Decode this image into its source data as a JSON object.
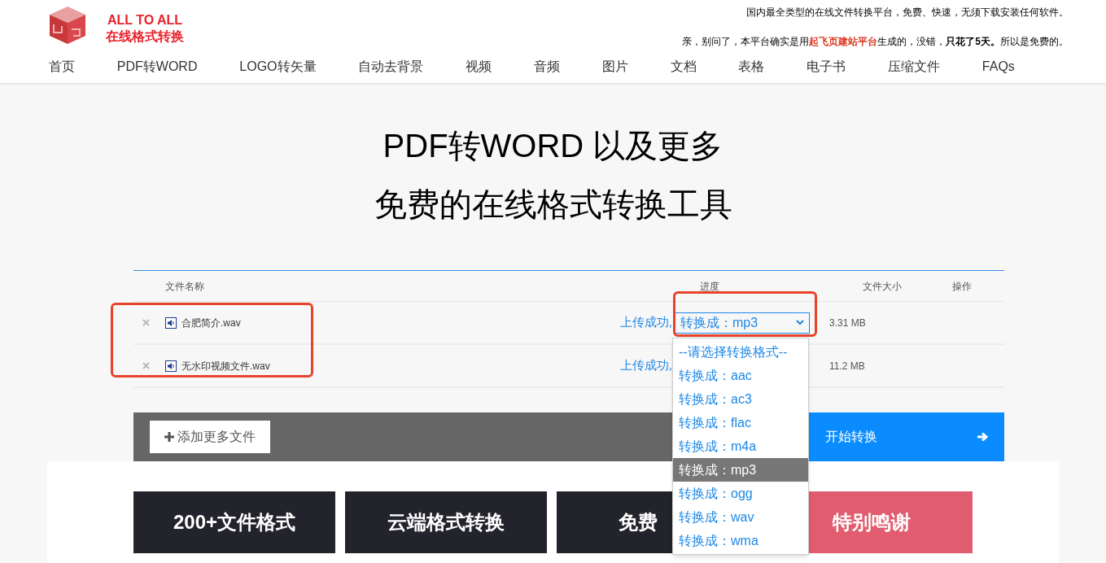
{
  "header": {
    "logo_title": "ALL TO ALL",
    "logo_subtitle": "在线格式转换",
    "tagline": "国内最全类型的在线文件转换平台，免费、快速，无须下载安装任何软件。",
    "notice": [
      {
        "kind": "plain",
        "text": "亲，别问了，本平台确实是用"
      },
      {
        "kind": "link",
        "text": "起飞页建站平台"
      },
      {
        "kind": "plain",
        "text": "生成的，没错，"
      },
      {
        "kind": "bold",
        "text": "只花了5天。"
      },
      {
        "kind": "plain",
        "text": "所以是免费的。"
      }
    ]
  },
  "nav": [
    "首页",
    "PDF转WORD",
    "LOGO转矢量",
    "自动去背景",
    "视频",
    "音频",
    "图片",
    "文档",
    "表格",
    "电子书",
    "压缩文件",
    "FAQs"
  ],
  "hero": [
    "PDF转WORD 以及更多",
    "免费的在线格式转换工具"
  ],
  "table": {
    "columns": [
      "文件名称",
      "进度",
      "文件大小",
      "操作"
    ],
    "rows": [
      {
        "name": "合肥简介.wav",
        "status": "上传成功,",
        "format": "转换成：mp3",
        "size": "3.31 MB"
      },
      {
        "name": "无水印视频文件.wav",
        "status": "上传成功,",
        "format": "",
        "size": "11.2 MB"
      }
    ]
  },
  "dropdown": [
    {
      "label": "--请选择转换格式--",
      "selected": false
    },
    {
      "label": "转换成：aac",
      "selected": false
    },
    {
      "label": "转换成：ac3",
      "selected": false
    },
    {
      "label": "转换成：flac",
      "selected": false
    },
    {
      "label": "转换成：m4a",
      "selected": false
    },
    {
      "label": "转换成：mp3",
      "selected": true
    },
    {
      "label": "转换成：ogg",
      "selected": false
    },
    {
      "label": "转换成：wav",
      "selected": false
    },
    {
      "label": "转换成：wma",
      "selected": false
    }
  ],
  "actions": {
    "add": "添加更多文件",
    "start": "开始转换"
  },
  "cards": [
    {
      "title": "200+文件格式",
      "color": "#22232b",
      "kind": "full"
    },
    {
      "title": "云端格式转换",
      "color": "#22232b",
      "kind": "full"
    },
    {
      "title": "免费",
      "color": "#22232b",
      "kind": "partial"
    },
    {
      "title": "特别鸣谢",
      "color": "#e05c6e",
      "kind": "full"
    }
  ]
}
